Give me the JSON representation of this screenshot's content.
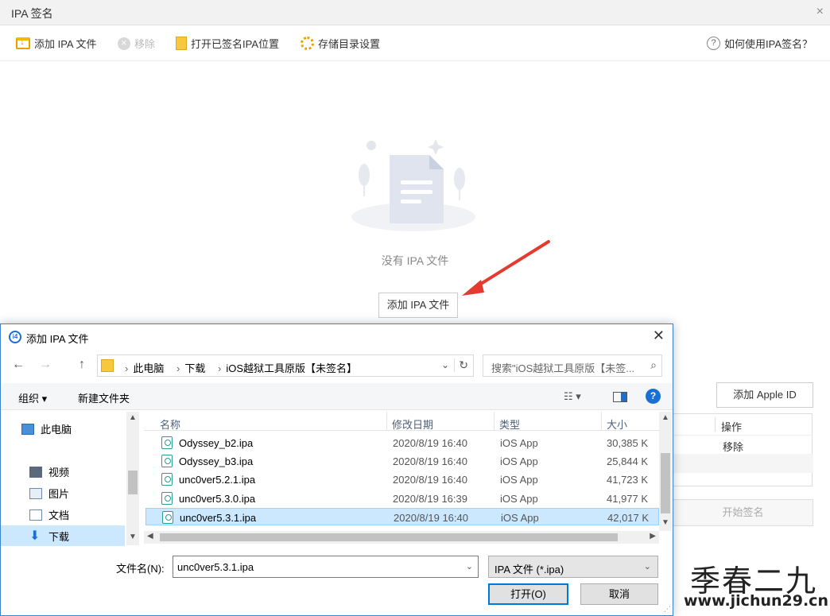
{
  "window": {
    "title": "IPA 签名",
    "close": "×"
  },
  "toolbar": {
    "add_ipa": "添加 IPA 文件",
    "remove": "移除",
    "open_signed": "打开已签名IPA位置",
    "storage_settings": "存储目录设置",
    "help": "如何使用IPA签名？"
  },
  "main": {
    "empty_text": "没有 IPA 文件",
    "add_button": "添加 IPA 文件"
  },
  "right_panel": {
    "add_apple_id": "添加 Apple ID",
    "col_action": "操作",
    "row_action": "移除",
    "start_sign": "开始签名"
  },
  "dialog": {
    "logo": "i4",
    "title": "添加 IPA 文件",
    "close": "✕",
    "nav": {
      "back": "←",
      "forward": "→",
      "up": "↑"
    },
    "breadcrumb": [
      "此电脑",
      "下载",
      "iOS越狱工具原版【未签名】"
    ],
    "search_placeholder": "搜索\"iOS越狱工具原版【未签...",
    "organize": "组织 ▾",
    "new_folder": "新建文件夹",
    "sidebar": [
      {
        "label": "此电脑",
        "icon": "computer-icon"
      },
      {
        "label": "视频",
        "icon": "video-icon"
      },
      {
        "label": "图片",
        "icon": "picture-icon"
      },
      {
        "label": "文档",
        "icon": "document-icon"
      },
      {
        "label": "下载",
        "icon": "download-icon"
      }
    ],
    "columns": {
      "name": "名称",
      "modified": "修改日期",
      "type": "类型",
      "size": "大小"
    },
    "files": [
      {
        "name": "Odyssey_b2.ipa",
        "date": "2020/8/19 16:40",
        "type": "iOS App",
        "size": "30,385 K"
      },
      {
        "name": "Odyssey_b3.ipa",
        "date": "2020/8/19 16:40",
        "type": "iOS App",
        "size": "25,844 K"
      },
      {
        "name": "unc0ver5.2.1.ipa",
        "date": "2020/8/19 16:40",
        "type": "iOS App",
        "size": "41,723 K"
      },
      {
        "name": "unc0ver5.3.0.ipa",
        "date": "2020/8/19 16:39",
        "type": "iOS App",
        "size": "41,977 K"
      },
      {
        "name": "unc0ver5.3.1.ipa",
        "date": "2020/8/19 16:40",
        "type": "iOS App",
        "size": "42,017 K"
      }
    ],
    "filename_label": "文件名(N):",
    "filename_value": "unc0ver5.3.1.ipa",
    "filetype_value": "IPA 文件 (*.ipa)",
    "open": "打开(O)",
    "cancel": "取消"
  },
  "watermark": {
    "line1": "季春二九",
    "line2": "www.jichun29.cn"
  }
}
